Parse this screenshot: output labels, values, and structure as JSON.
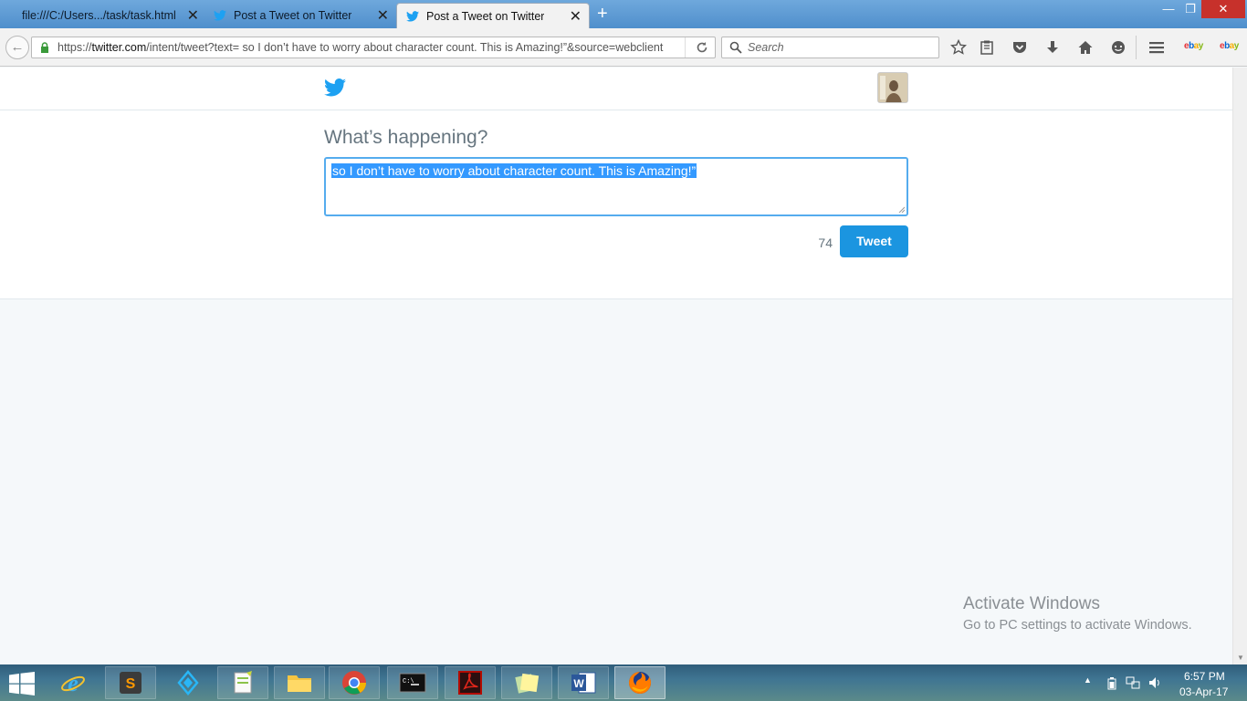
{
  "browser": {
    "tabs": [
      {
        "label": "file:///C:/Users.../task/task.html",
        "active": false
      },
      {
        "label": "Post a Tweet on Twitter",
        "active": false
      },
      {
        "label": "Post a Tweet on Twitter",
        "active": true
      }
    ],
    "new_tab": "+",
    "url_prefix": "https://",
    "url_domain": "twitter.com",
    "url_rest": "/intent/tweet?text= so I don’t have to worry about character count. This is Amazing!”&source=webclient",
    "search_placeholder": "Search",
    "window_controls": {
      "minimize": "—",
      "restore": "❐",
      "close": "✕"
    }
  },
  "page": {
    "compose_title": "What’s happening?",
    "tweet_text": " so I don’t have to worry about character count. This is Amazing!”",
    "char_count": "74",
    "tweet_button": "Tweet",
    "brand_color": "#1da1f2"
  },
  "watermark": {
    "title": "Activate Windows",
    "subtitle": "Go to PC settings to activate Windows."
  },
  "taskbar": {
    "apps": [
      "internet-explorer",
      "sublime-text",
      "app-launcher",
      "notepad-plus-plus",
      "file-explorer",
      "chrome",
      "command-prompt",
      "acrobat-reader",
      "sticky-notes",
      "word",
      "firefox"
    ],
    "clock_time": "6:57 PM",
    "clock_date": "03-Apr-17"
  }
}
